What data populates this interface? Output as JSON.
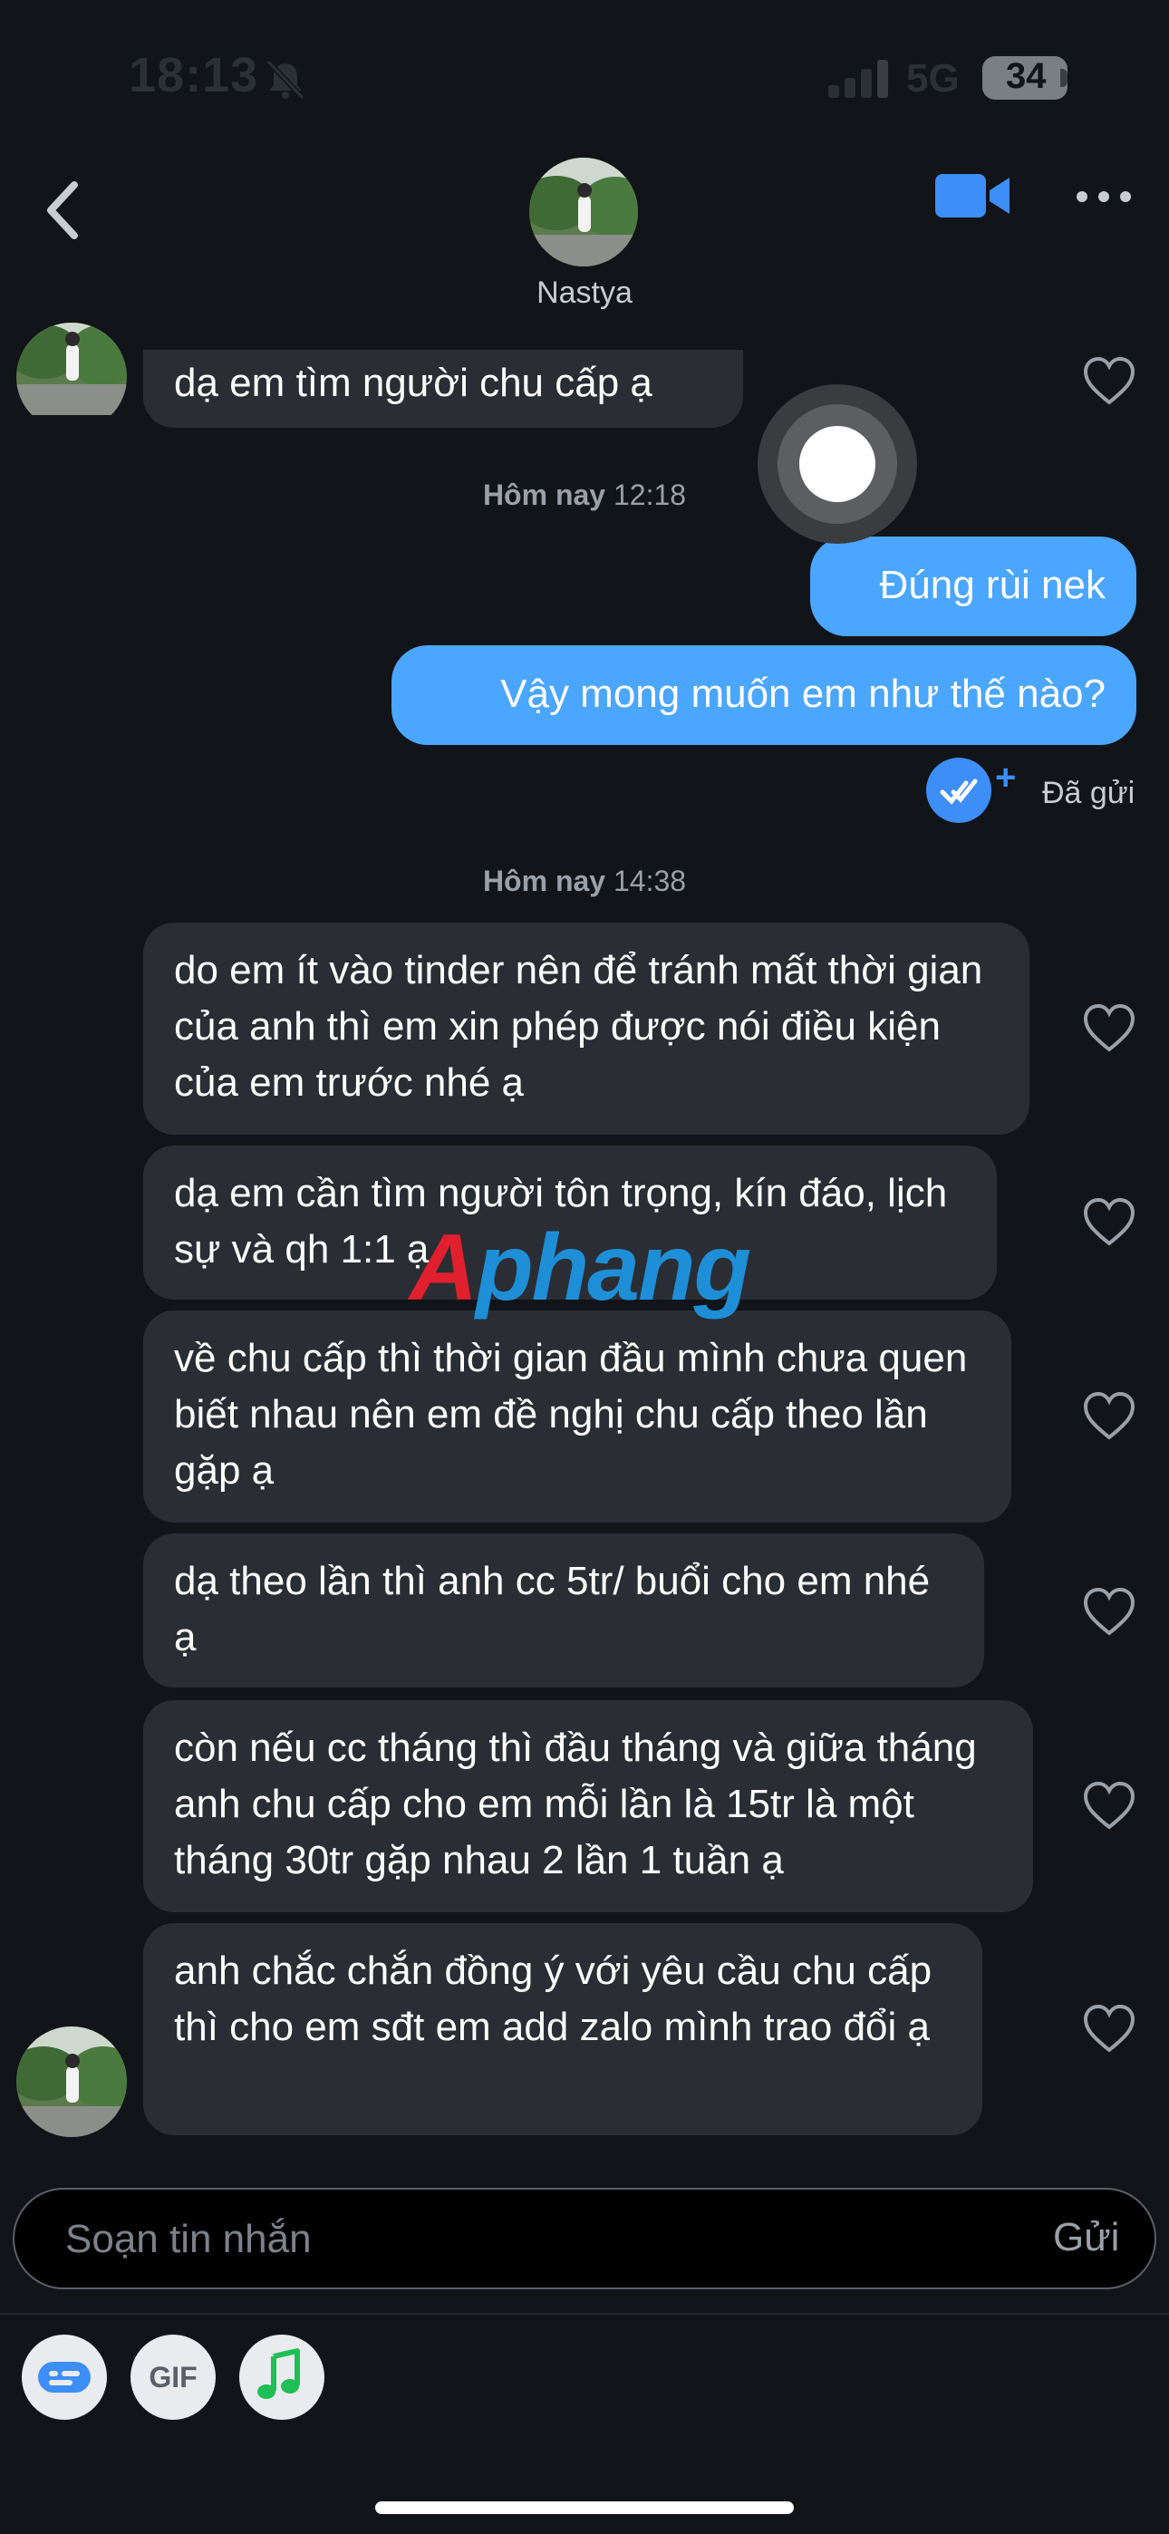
{
  "status": {
    "time": "18:13",
    "network": "5G",
    "battery": "34"
  },
  "header": {
    "name": "Nastya"
  },
  "messages": [
    {
      "dir": "in",
      "text": "dạ em tìm người chu cấp ạ"
    },
    {
      "dir": "out",
      "text": "Đúng rùi nek"
    },
    {
      "dir": "out",
      "text": "Vậy mong muốn em như thế nào?"
    },
    {
      "dir": "in",
      "text": "do em ít vào tinder nên để tránh mất thời gian của anh thì em xin phép được nói điều kiện của em trước nhé ạ"
    },
    {
      "dir": "in",
      "text": "dạ em cần tìm người tôn trọng, kín đáo, lịch sự và qh 1:1 ạ"
    },
    {
      "dir": "in",
      "text": "về chu cấp thì thời gian đầu mình chưa quen biết nhau nên em đề nghị chu cấp theo lần gặp ạ"
    },
    {
      "dir": "in",
      "text": "dạ theo lần thì anh cc 5tr/ buổi cho em nhé ạ"
    },
    {
      "dir": "in",
      "text": "còn nếu cc tháng thì đầu tháng và giữa tháng anh chu cấp cho em mỗi lần là 15tr là một tháng 30tr gặp nhau 2 lần 1 tuần ạ"
    },
    {
      "dir": "in",
      "text": "anh chắc chắn đồng ý với yêu cầu chu cấp thì cho em sđt em add zalo mình trao đổi ạ"
    }
  ],
  "timestamps": [
    {
      "day": "Hôm nay",
      "time": "12:18"
    },
    {
      "day": "Hôm nay",
      "time": "14:38"
    }
  ],
  "read_status": "Đã gửi",
  "watermark": {
    "part1": "A",
    "part2": "phang"
  },
  "composer": {
    "placeholder": "Soạn tin nhắn",
    "send_label": "Gửi"
  },
  "tools": {
    "gif_label": "GIF"
  },
  "colors": {
    "outgoing_bubble": "#4aa6ff",
    "incoming_bubble": "#2a2d34",
    "background": "#111418",
    "accent": "#3d8ef7"
  },
  "icons": [
    "back-chevron-icon",
    "video-call-icon",
    "more-icon",
    "heart-icon",
    "sticker-icon",
    "gif-icon",
    "music-icon",
    "read-check-icon"
  ]
}
